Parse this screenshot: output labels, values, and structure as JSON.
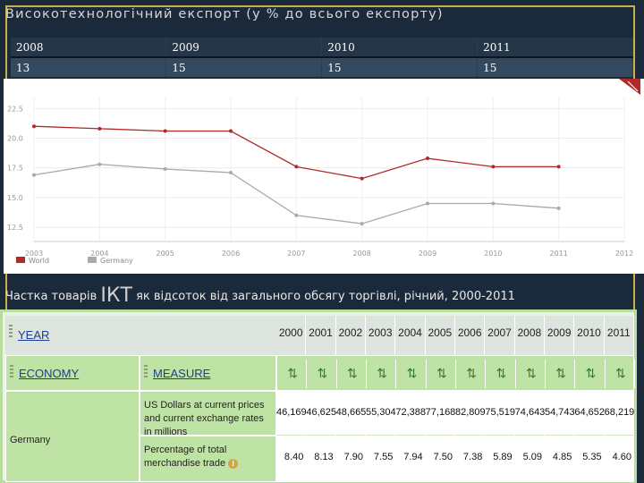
{
  "top_title": "Високотехнологічний експорт (у % до всього експорту)",
  "summary_table": {
    "years": [
      "2008",
      "2009",
      "2010",
      "2011"
    ],
    "values": [
      "13",
      "15",
      "15",
      "15"
    ]
  },
  "chart_data": {
    "type": "line",
    "x": [
      2003,
      2004,
      2005,
      2006,
      2007,
      2008,
      2009,
      2010,
      2011
    ],
    "x_ticks": [
      "2003",
      "2004",
      "2005",
      "2006",
      "2007",
      "2008",
      "2009",
      "2010",
      "2011",
      "2012"
    ],
    "y_ticks": [
      "22.5",
      "20.0",
      "17.5",
      "15.0",
      "12.5"
    ],
    "ylim": [
      11.3,
      23.5
    ],
    "xlim": [
      2003,
      2012
    ],
    "series": [
      {
        "name": "World",
        "color": "#b02a2a",
        "values": [
          21.0,
          20.8,
          20.6,
          20.6,
          17.6,
          16.6,
          18.3,
          17.6,
          17.6
        ]
      },
      {
        "name": "Germany",
        "color": "#a9a9a9",
        "values": [
          16.9,
          17.8,
          17.4,
          17.1,
          13.5,
          12.8,
          14.5,
          14.5,
          14.1
        ]
      }
    ],
    "grid": true,
    "legend": "bottom-left"
  },
  "mid_title": {
    "prefix": "Частка товарів",
    "big": "ІКТ",
    "suffix": "як відсоток від загального обсягу торгівлі, річний, 2000-2011"
  },
  "oecd": {
    "year_label": "YEAR",
    "economy_label": "ECONOMY",
    "measure_label": "MEASURE",
    "years": [
      "2000",
      "2001",
      "2002",
      "2003",
      "2004",
      "2005",
      "2006",
      "2007",
      "2008",
      "2009",
      "2010",
      "2011"
    ],
    "country": "Germany",
    "rows": [
      {
        "measure": "US Dollars at current prices and current exchange rates in millions",
        "values": [
          "46,169",
          "46,625",
          "48,665",
          "55,304",
          "72,388",
          "77,168",
          "82,809",
          "75,519",
          "74,643",
          "54,743",
          "64,652",
          "68,219"
        ]
      },
      {
        "measure": "Percentage of total merchandise trade",
        "values": [
          "8.40",
          "8.13",
          "7.90",
          "7.55",
          "7.94",
          "7.50",
          "7.38",
          "5.89",
          "5.09",
          "4.85",
          "5.35",
          "4.60"
        ]
      }
    ]
  }
}
